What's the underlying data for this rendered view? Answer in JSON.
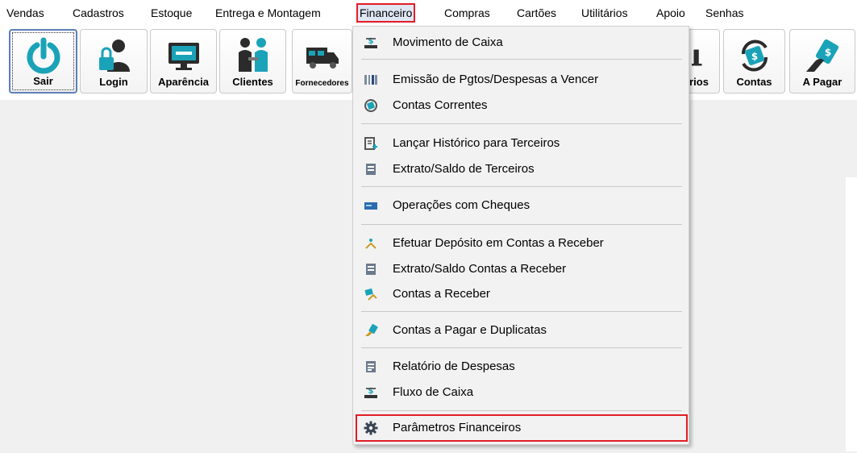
{
  "menubar": {
    "items": [
      "Vendas",
      "Cadastros",
      "Estoque",
      "Entrega e Montagem",
      "Financeiro",
      "Compras",
      "Cartões",
      "Utilitários",
      "Apoio",
      "Senhas"
    ],
    "active": "Financeiro"
  },
  "toolbar": {
    "buttons": [
      "Sair",
      "Login",
      "Aparência",
      "Clientes",
      "Fornecedores",
      "rios",
      "Contas",
      "A Pagar"
    ]
  },
  "financeiro_menu": {
    "items": [
      "Movimento de Caixa",
      "Emissão de Pgtos/Despesas a Vencer",
      "Contas Correntes",
      "Lançar Histórico para Terceiros",
      "Extrato/Saldo de Terceiros",
      "Operações com Cheques",
      "Efetuar Depósito em Contas a Receber",
      "Extrato/Saldo Contas a Receber",
      "Contas a Receber",
      "Contas a Pagar e Duplicatas",
      "Relatório de Despesas",
      "Fluxo de Caixa",
      "Parâmetros Financeiros"
    ],
    "highlighted": "Parâmetros Financeiros"
  },
  "colors": {
    "highlight_border": "#e21c25",
    "icon_teal": "#1aa3b8",
    "icon_dark": "#2b2b2b"
  }
}
